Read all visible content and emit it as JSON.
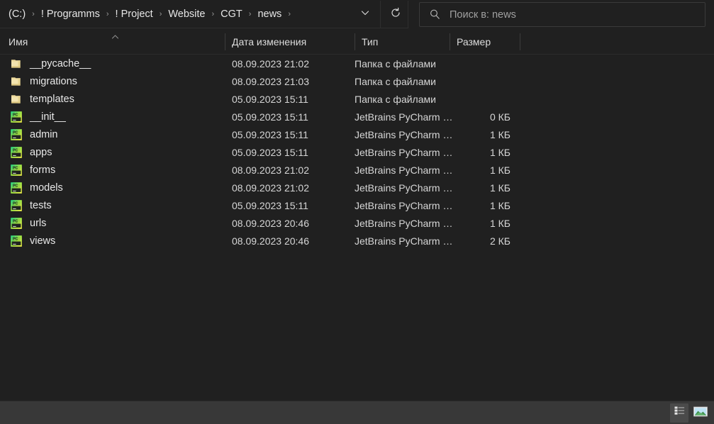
{
  "addressbar": {
    "breadcrumbs": [
      {
        "label": "(C:)"
      },
      {
        "label": "! Programms"
      },
      {
        "label": "! Project"
      },
      {
        "label": "Website"
      },
      {
        "label": "CGT"
      },
      {
        "label": "news"
      }
    ],
    "separator": "›",
    "history_icon": "chevron-down-icon",
    "refresh_icon": "refresh-icon"
  },
  "search": {
    "icon": "search-icon",
    "placeholder": "Поиск в: news",
    "value": ""
  },
  "columns": {
    "name": "Имя",
    "date_modified": "Дата изменения",
    "type": "Тип",
    "size": "Размер",
    "sort_indicator": "ascending"
  },
  "files": [
    {
      "icon": "folder-icon",
      "name": "__pycache__",
      "date": "08.09.2023 21:02",
      "type": "Папка с файлами",
      "size": ""
    },
    {
      "icon": "folder-icon",
      "name": "migrations",
      "date": "08.09.2023 21:03",
      "type": "Папка с файлами",
      "size": ""
    },
    {
      "icon": "folder-icon",
      "name": "templates",
      "date": "05.09.2023 15:11",
      "type": "Папка с файлами",
      "size": ""
    },
    {
      "icon": "pycharm-icon",
      "name": "__init__",
      "date": "05.09.2023 15:11",
      "type": "JetBrains PyCharm …",
      "size": "0 КБ"
    },
    {
      "icon": "pycharm-icon",
      "name": "admin",
      "date": "05.09.2023 15:11",
      "type": "JetBrains PyCharm …",
      "size": "1 КБ"
    },
    {
      "icon": "pycharm-icon",
      "name": "apps",
      "date": "05.09.2023 15:11",
      "type": "JetBrains PyCharm …",
      "size": "1 КБ"
    },
    {
      "icon": "pycharm-icon",
      "name": "forms",
      "date": "08.09.2023 21:02",
      "type": "JetBrains PyCharm …",
      "size": "1 КБ"
    },
    {
      "icon": "pycharm-icon",
      "name": "models",
      "date": "08.09.2023 21:02",
      "type": "JetBrains PyCharm …",
      "size": "1 КБ"
    },
    {
      "icon": "pycharm-icon",
      "name": "tests",
      "date": "05.09.2023 15:11",
      "type": "JetBrains PyCharm …",
      "size": "1 КБ"
    },
    {
      "icon": "pycharm-icon",
      "name": "urls",
      "date": "08.09.2023 20:46",
      "type": "JetBrains PyCharm …",
      "size": "1 КБ"
    },
    {
      "icon": "pycharm-icon",
      "name": "views",
      "date": "08.09.2023 20:46",
      "type": "JetBrains PyCharm …",
      "size": "2 КБ"
    }
  ],
  "statusbar": {
    "status_text": "",
    "views": [
      {
        "name": "details-view-button",
        "icon": "details-view-icon",
        "active": true
      },
      {
        "name": "large-icons-view-button",
        "icon": "large-icons-view-icon",
        "active": false
      }
    ]
  },
  "colors": {
    "background": "#202020",
    "statusbar": "#383838",
    "text": "#e8e8e8",
    "muted_text": "#a0a0a0",
    "folder": "#efdfa8",
    "pycharm_green": "#21d789",
    "pycharm_yellow": "#fcf84a"
  }
}
